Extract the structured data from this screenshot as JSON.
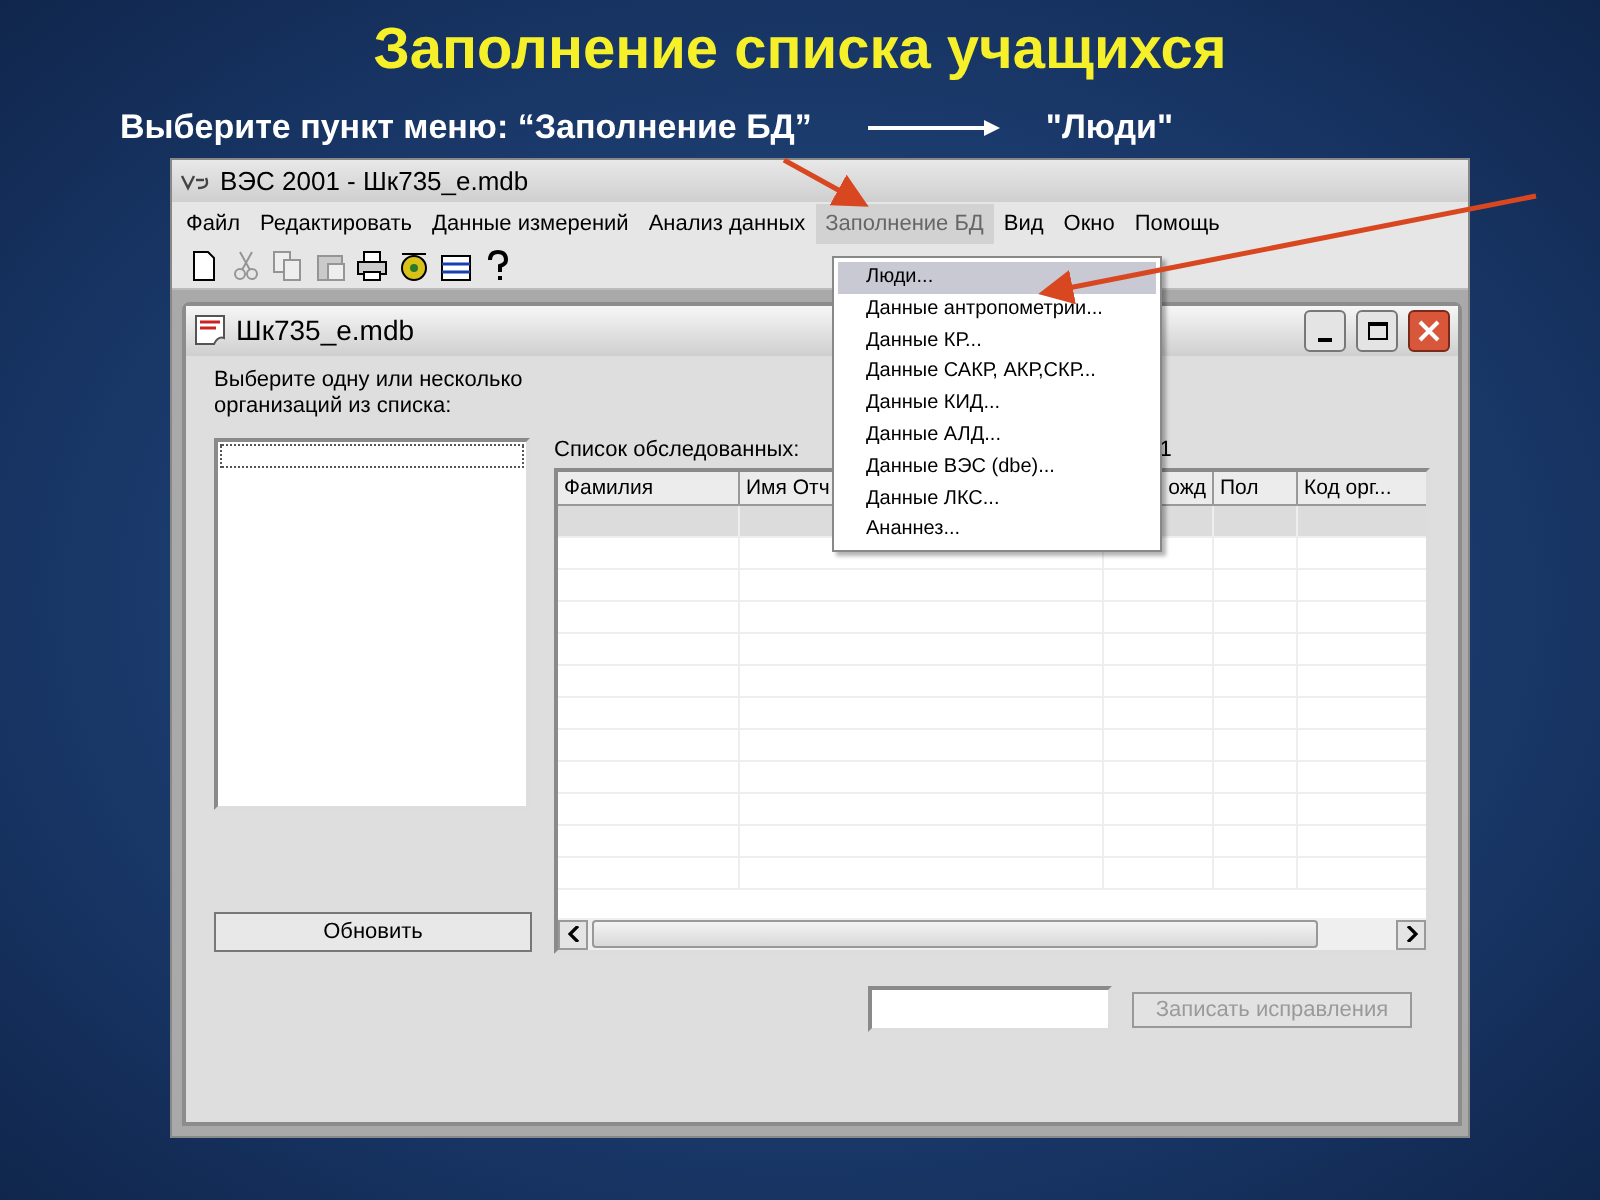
{
  "slide": {
    "title": "Заполнение списка учащихся",
    "instruction": "Выберите пункт меню: “Заполнение БД”",
    "target": "\"Люди\""
  },
  "window": {
    "title": "ВЭС 2001 - Шк735_e.mdb",
    "menu": [
      {
        "label": "Файл",
        "open": false
      },
      {
        "label": "Редактировать",
        "open": false
      },
      {
        "label": "Данные измерений",
        "open": false
      },
      {
        "label": "Анализ данных",
        "open": false
      },
      {
        "label": "Заполнение БД",
        "open": true
      },
      {
        "label": "Вид",
        "open": false
      },
      {
        "label": "Окно",
        "open": false
      },
      {
        "label": "Помощь",
        "open": false
      }
    ],
    "toolbar": [
      {
        "kind": "new",
        "disabled": false
      },
      {
        "kind": "cut",
        "disabled": true
      },
      {
        "kind": "copy",
        "disabled": true
      },
      {
        "kind": "paste",
        "disabled": true
      },
      {
        "kind": "print",
        "disabled": false
      },
      {
        "kind": "disc",
        "disabled": false
      },
      {
        "kind": "table",
        "disabled": false
      },
      {
        "kind": "help",
        "disabled": false
      }
    ],
    "dropdown": [
      {
        "label": "Люди...",
        "selected": true
      },
      {
        "label": "Данные антропометрии...",
        "selected": false
      },
      {
        "label": "Данные КР...",
        "selected": false
      },
      {
        "label": "Данные САКР, АКР,СКР...",
        "selected": false
      },
      {
        "label": "Данные КИД...",
        "selected": false
      },
      {
        "label": "Данные АЛД...",
        "selected": false
      },
      {
        "label": "Данные ВЭС (dbe)...",
        "selected": false
      },
      {
        "label": "Данные ЛКС...",
        "selected": false
      },
      {
        "label": "Ананнез...",
        "selected": false
      }
    ]
  },
  "child_window": {
    "title": "Шк735_e.mdb",
    "prompt": "Выберите одну или несколько организаций из списка:",
    "refresh_button": "Обновить",
    "list_label": "Список обследованных:",
    "count": "1",
    "table": {
      "columns": [
        "Фамилия",
        "Имя Отч",
        "ожд",
        "Пол",
        "Код орг..."
      ],
      "rows": [
        {
          "selected": true
        },
        {
          "selected": false
        },
        {
          "selected": false
        },
        {
          "selected": false
        },
        {
          "selected": false
        },
        {
          "selected": false
        },
        {
          "selected": false
        },
        {
          "selected": false
        },
        {
          "selected": false
        },
        {
          "selected": false
        },
        {
          "selected": false
        },
        {
          "selected": false
        }
      ]
    },
    "save_button": {
      "label": "Записать исправления",
      "disabled": true
    }
  }
}
